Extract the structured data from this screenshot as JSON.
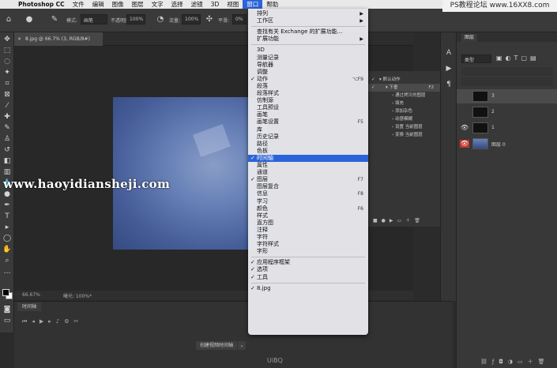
{
  "menubar": {
    "apple_icon": "apple-logo",
    "items": [
      "Photoshop CC",
      "文件",
      "编辑",
      "图像",
      "图层",
      "文字",
      "选择",
      "滤镜",
      "3D",
      "视图",
      "窗口",
      "帮助"
    ],
    "active_index": 10
  },
  "options_bar": {
    "mode_label": "模式:",
    "mode_value": "画笔",
    "opacity_label": "不透明度:",
    "opacity_value": "100%",
    "flow_label": "流量:",
    "flow_value": "100%",
    "smooth_label": "平滑:",
    "smooth_value": "0%"
  },
  "document": {
    "tab_title": "8.jpg @ 66.7% (3, RGB/8#)",
    "close_glyph": "×"
  },
  "status_bar": {
    "zoom": "66.67%",
    "exposure": "曝光: 100%*"
  },
  "timeline": {
    "tab_label": "时间轴",
    "create_button": "创建视频时间轴",
    "create_arrow": "⌄"
  },
  "actions_panel": {
    "rows": [
      {
        "check": "✓",
        "label": "默认动作",
        "indent": 1,
        "key": ""
      },
      {
        "check": "✓",
        "label": "下垂",
        "indent": 2,
        "key": "F2",
        "selected": true
      },
      {
        "check": "",
        "label": "通过拷贝的图层",
        "indent": 3,
        "key": ""
      },
      {
        "check": "",
        "label": "填充",
        "indent": 3,
        "key": ""
      },
      {
        "check": "",
        "label": "添加杂色",
        "indent": 3,
        "key": ""
      },
      {
        "check": "",
        "label": "动感模糊",
        "indent": 3,
        "key": ""
      },
      {
        "check": "",
        "label": "设置 当前图层",
        "indent": 3,
        "key": ""
      },
      {
        "check": "",
        "label": "变换 当前图层",
        "indent": 3,
        "key": ""
      }
    ]
  },
  "layers_panel": {
    "title": "图层",
    "filter": "类型",
    "layers": [
      {
        "name": "3",
        "visible": false,
        "selected": true
      },
      {
        "name": "2",
        "visible": false
      },
      {
        "name": "1",
        "visible": true
      },
      {
        "name": "图层 0",
        "visible": true,
        "background": true
      }
    ]
  },
  "window_menu": {
    "rows": [
      {
        "check": "",
        "label": "排列",
        "key": "",
        "submenu": true
      },
      {
        "check": "",
        "label": "工作区",
        "key": "",
        "submenu": true
      },
      {
        "sep": true
      },
      {
        "check": "",
        "label": "查找有关 Exchange 的扩展功能...",
        "key": ""
      },
      {
        "check": "",
        "label": "扩展功能",
        "key": "",
        "submenu": true
      },
      {
        "sep": true
      },
      {
        "check": "",
        "label": "3D",
        "key": ""
      },
      {
        "check": "",
        "label": "测量记录",
        "key": ""
      },
      {
        "check": "",
        "label": "导航器",
        "key": ""
      },
      {
        "check": "",
        "label": "调整",
        "key": ""
      },
      {
        "check": "✓",
        "label": "动作",
        "key": "⌥F9"
      },
      {
        "check": "",
        "label": "段落",
        "key": ""
      },
      {
        "check": "",
        "label": "段落样式",
        "key": ""
      },
      {
        "check": "",
        "label": "仿制源",
        "key": ""
      },
      {
        "check": "",
        "label": "工具预设",
        "key": ""
      },
      {
        "check": "",
        "label": "画笔",
        "key": ""
      },
      {
        "check": "",
        "label": "画笔设置",
        "key": "F5"
      },
      {
        "check": "",
        "label": "库",
        "key": ""
      },
      {
        "check": "",
        "label": "历史记录",
        "key": ""
      },
      {
        "check": "",
        "label": "路径",
        "key": ""
      },
      {
        "check": "",
        "label": "色板",
        "key": ""
      },
      {
        "check": "✓",
        "label": "时间轴",
        "key": "",
        "highlighted": true
      },
      {
        "check": "",
        "label": "属性",
        "key": ""
      },
      {
        "check": "",
        "label": "通道",
        "key": ""
      },
      {
        "check": "✓",
        "label": "图层",
        "key": "F7"
      },
      {
        "check": "",
        "label": "图层复合",
        "key": ""
      },
      {
        "check": "",
        "label": "信息",
        "key": "F8"
      },
      {
        "check": "",
        "label": "学习",
        "key": ""
      },
      {
        "check": "",
        "label": "颜色",
        "key": "F6"
      },
      {
        "check": "",
        "label": "样式",
        "key": ""
      },
      {
        "check": "",
        "label": "直方图",
        "key": ""
      },
      {
        "check": "",
        "label": "注释",
        "key": ""
      },
      {
        "check": "",
        "label": "字符",
        "key": ""
      },
      {
        "check": "",
        "label": "字符样式",
        "key": ""
      },
      {
        "check": "",
        "label": "字形",
        "key": ""
      },
      {
        "sep": true
      },
      {
        "check": "✓",
        "label": "应用程序框架",
        "key": ""
      },
      {
        "check": "✓",
        "label": "选项",
        "key": ""
      },
      {
        "check": "✓",
        "label": "工具",
        "key": ""
      },
      {
        "sep": true
      },
      {
        "check": "✓",
        "label": "8.jpg",
        "key": ""
      }
    ]
  },
  "watermarks": {
    "site": "PS教程论坛 www.16XX8.com",
    "url": "www.haoyidiansheji.com",
    "brand": "UiBQ"
  },
  "colors": {
    "menu_highlight": "#2c64d8",
    "panel_bg": "#383838",
    "canvas_bg": "#282828",
    "background_layer_eye": "#c0392b"
  }
}
